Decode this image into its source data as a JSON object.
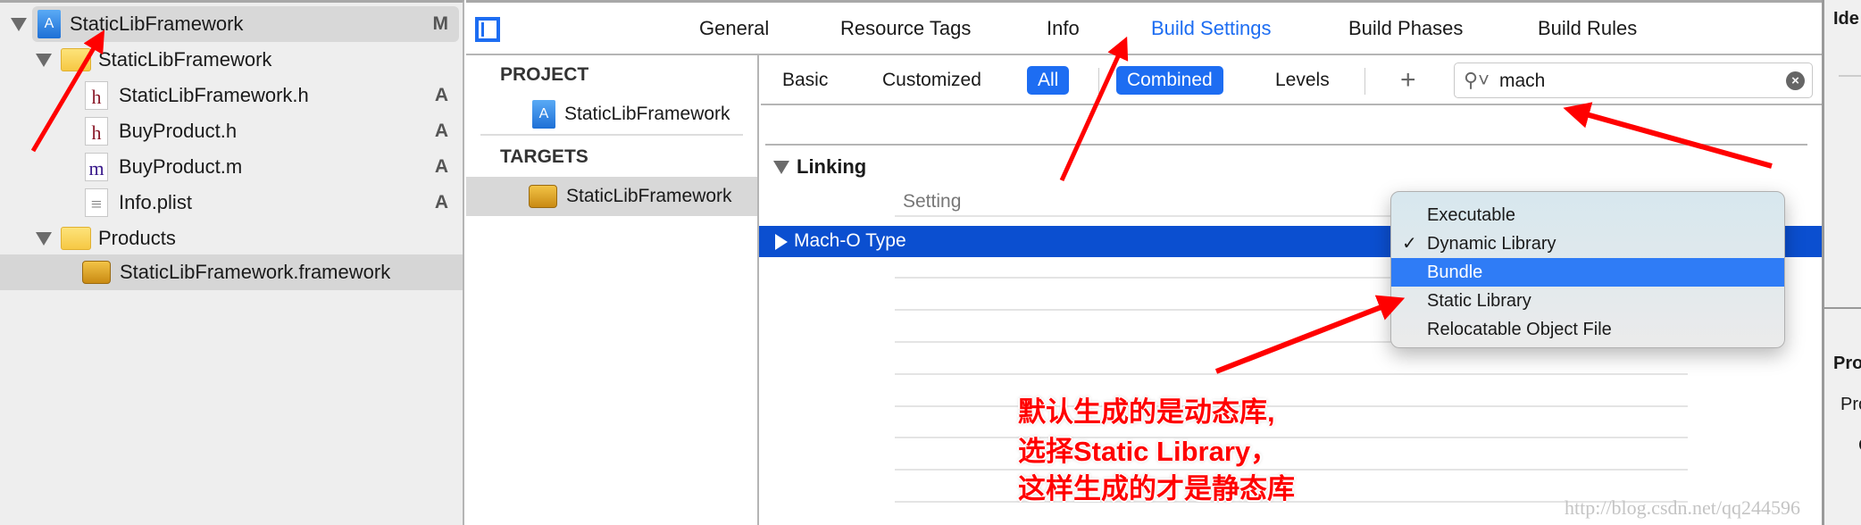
{
  "navigator": {
    "items": [
      {
        "label": "StaticLibFramework",
        "badge": "M",
        "icon": "xcode-project-icon"
      },
      {
        "label": "StaticLibFramework",
        "badge": "",
        "icon": "folder-icon"
      },
      {
        "label": "StaticLibFramework.h",
        "badge": "A",
        "icon": "header-file-icon",
        "glyph": "h"
      },
      {
        "label": "BuyProduct.h",
        "badge": "A",
        "icon": "header-file-icon",
        "glyph": "h"
      },
      {
        "label": "BuyProduct.m",
        "badge": "A",
        "icon": "objc-file-icon",
        "glyph": "m"
      },
      {
        "label": "Info.plist",
        "badge": "A",
        "icon": "plist-file-icon",
        "glyph": "≡"
      },
      {
        "label": "Products",
        "badge": "",
        "icon": "folder-icon"
      },
      {
        "label": "StaticLibFramework.framework",
        "badge": "",
        "icon": "framework-icon"
      }
    ]
  },
  "tabs": [
    "General",
    "Resource Tags",
    "Info",
    "Build Settings",
    "Build Phases",
    "Build Rules"
  ],
  "active_tab": "Build Settings",
  "project_list": {
    "project_header": "PROJECT",
    "project": "StaticLibFramework",
    "targets_header": "TARGETS",
    "target": "StaticLibFramework"
  },
  "filter": {
    "basic": "Basic",
    "customized": "Customized",
    "all": "All",
    "combined": "Combined",
    "levels": "Levels",
    "add": "+",
    "search_value": "mach"
  },
  "settings": {
    "section": "Linking",
    "column_setting": "Setting",
    "row": "Mach-O Type"
  },
  "menu": {
    "items": [
      "Executable",
      "Dynamic Library",
      "Bundle",
      "Static Library",
      "Relocatable Object File"
    ],
    "checked": "Dynamic Library",
    "highlighted": "Bundle"
  },
  "inspector": {
    "identity": "Ide",
    "pro1": "Pro",
    "pro2": "Pro",
    "c": "C"
  },
  "annotation": {
    "line1": "默认生成的是动态库,",
    "line2": "选择Static Library，",
    "line3": "这样生成的才是静态库"
  },
  "watermark": "http://blog.csdn.net/qq244596",
  "colors": {
    "accent": "#1d6df2",
    "selection": "#0b4fd0",
    "annotation": "#ff0000"
  }
}
